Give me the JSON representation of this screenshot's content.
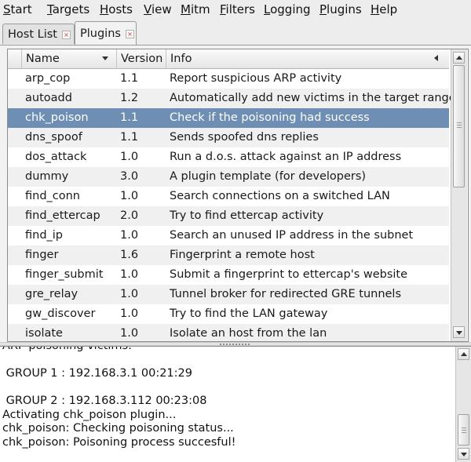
{
  "menu": [
    "Start",
    "Targets",
    "Hosts",
    "View",
    "Mitm",
    "Filters",
    "Logging",
    "Plugins",
    "Help"
  ],
  "tabs": [
    {
      "label": "Host List",
      "active": false
    },
    {
      "label": "Plugins",
      "active": true
    }
  ],
  "columns": {
    "name": "Name",
    "version": "Version",
    "info": "Info"
  },
  "plugins": [
    {
      "name": "arp_cop",
      "version": "1.1",
      "info": "Report suspicious ARP activity"
    },
    {
      "name": "autoadd",
      "version": "1.2",
      "info": "Automatically add new victims in the target range"
    },
    {
      "name": "chk_poison",
      "version": "1.1",
      "info": "Check if the poisoning had success",
      "selected": true
    },
    {
      "name": "dns_spoof",
      "version": "1.1",
      "info": "Sends spoofed dns replies"
    },
    {
      "name": "dos_attack",
      "version": "1.0",
      "info": "Run a d.o.s. attack against an IP address"
    },
    {
      "name": "dummy",
      "version": "3.0",
      "info": "A plugin template (for developers)"
    },
    {
      "name": "find_conn",
      "version": "1.0",
      "info": "Search connections on a switched LAN"
    },
    {
      "name": "find_ettercap",
      "version": "2.0",
      "info": "Try to find ettercap activity"
    },
    {
      "name": "find_ip",
      "version": "1.0",
      "info": "Search an unused IP address in the subnet"
    },
    {
      "name": "finger",
      "version": "1.6",
      "info": "Fingerprint a remote host"
    },
    {
      "name": "finger_submit",
      "version": "1.0",
      "info": "Submit a fingerprint to ettercap's website"
    },
    {
      "name": "gre_relay",
      "version": "1.0",
      "info": "Tunnel broker for redirected GRE tunnels"
    },
    {
      "name": "gw_discover",
      "version": "1.0",
      "info": "Try to find the LAN gateway"
    },
    {
      "name": "isolate",
      "version": "1.0",
      "info": "Isolate an host from the lan"
    }
  ],
  "console_lines": [
    "ARP poisoning victims:",
    "",
    " GROUP 1 : 192.168.3.1 00:21:29",
    "",
    " GROUP 2 : 192.168.3.112 00:23:08",
    "Activating chk_poison plugin...",
    "chk_poison: Checking poisoning status...",
    "chk_poison: Poisoning process succesful!"
  ],
  "colors": {
    "selection": "#6e8fb3",
    "alt_row": "#f0f0f0"
  }
}
